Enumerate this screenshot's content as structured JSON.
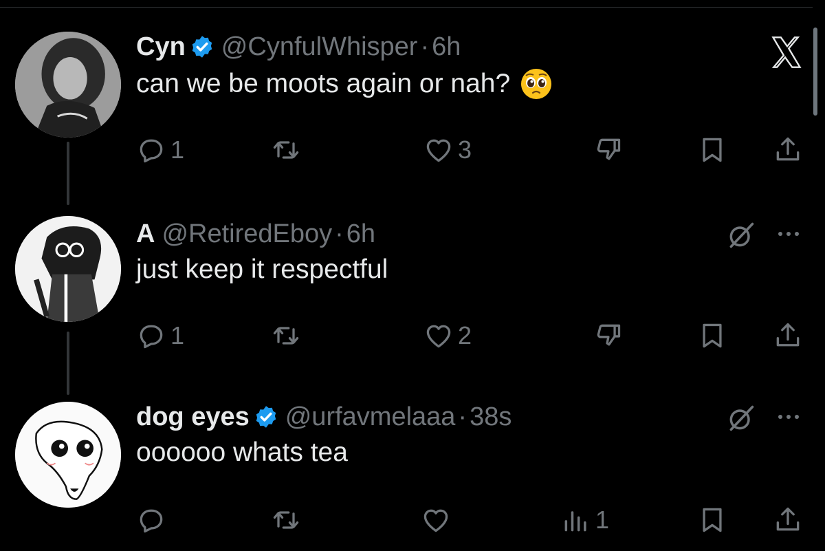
{
  "tweets": [
    {
      "name": "Cyn",
      "verified": true,
      "handle": "@CynfulWhisper",
      "sep": "·",
      "time": "6h",
      "text": "can we be moots again or nah?",
      "emoji": "pleading-face",
      "actions": {
        "replies": "1",
        "reposts": "",
        "likes": "3"
      }
    },
    {
      "name": "A",
      "verified": false,
      "handle": "@RetiredEboy",
      "sep": "·",
      "time": "6h",
      "text": "just keep it respectful",
      "actions": {
        "replies": "1",
        "reposts": "",
        "likes": "2"
      }
    },
    {
      "name": "dog eyes",
      "verified": true,
      "handle": "@urfavmelaaa",
      "sep": "·",
      "time": "38s",
      "text": "oooooo whats tea",
      "actions": {
        "replies": "",
        "reposts": "",
        "likes": "",
        "views": "1"
      }
    }
  ],
  "colors": {
    "background": "#000000",
    "text": "#e7e9ea",
    "muted": "#71767b",
    "verified": "#1d9bf0"
  },
  "icons": [
    "x-logo-icon",
    "verified-badge-icon",
    "reply-icon",
    "repost-icon",
    "like-icon",
    "dislike-icon",
    "bookmark-icon",
    "share-icon",
    "grok-icon",
    "more-icon",
    "views-icon"
  ]
}
